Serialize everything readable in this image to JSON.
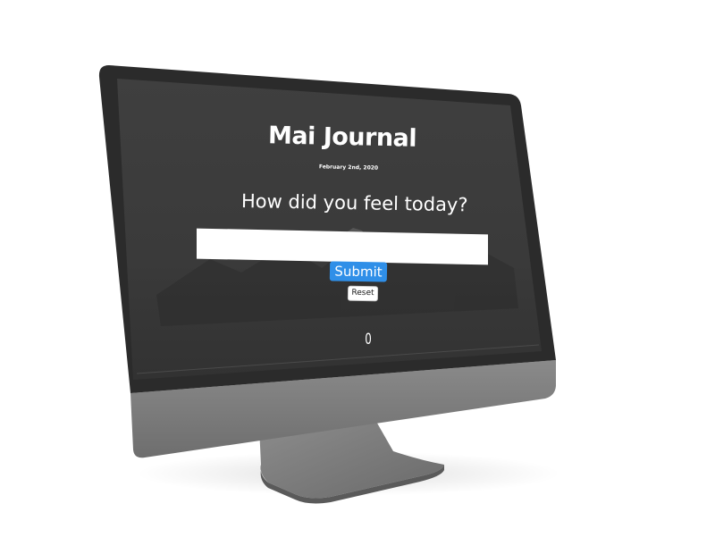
{
  "app": {
    "title": "Mai Journal",
    "date": "February 2nd, 2020"
  },
  "prompt": {
    "question": "How did you feel today?"
  },
  "entry": {
    "value": "",
    "placeholder": ""
  },
  "buttons": {
    "submit_label": "Submit",
    "reset_label": "Reset"
  },
  "counter": {
    "value": "0"
  },
  "colors": {
    "screen_background": "#3a3a3a",
    "submit_accent": "#2f8fe8",
    "bezel": "#2b2b2b",
    "chin": "#7a7a7a"
  },
  "icons": {
    "background_art": "mountain-landscape-icon"
  }
}
